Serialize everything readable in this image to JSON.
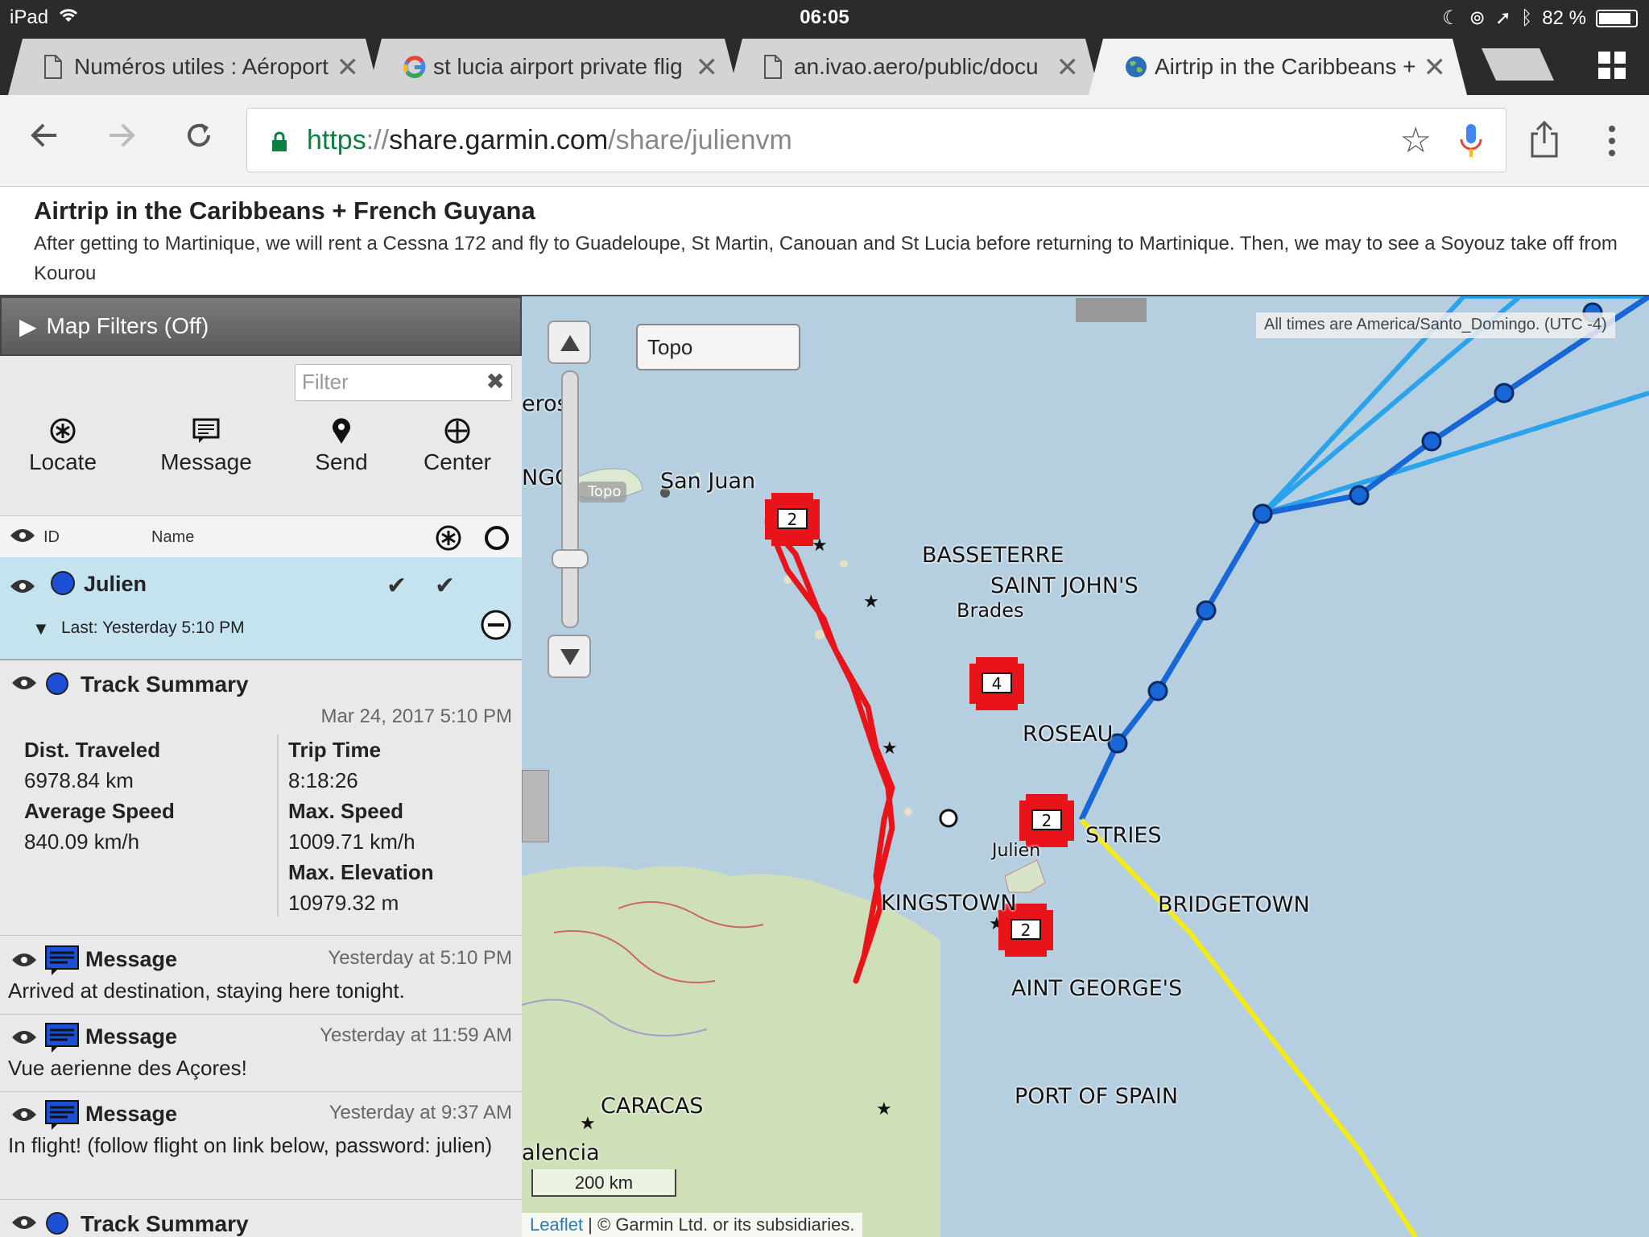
{
  "status_bar": {
    "device": "iPad",
    "time": "06:05",
    "battery": "82 %",
    "battery_level": 0.82
  },
  "tabs": [
    {
      "title": "Numéros utiles : Aéroport",
      "icon": "document-icon",
      "active": false
    },
    {
      "title": "st lucia airport private flig",
      "icon": "google-icon",
      "active": false
    },
    {
      "title": "an.ivao.aero/public/docu",
      "icon": "document-icon",
      "active": false
    },
    {
      "title": "Airtrip in the Caribbeans +",
      "icon": "globe-icon",
      "active": true
    }
  ],
  "url": {
    "scheme": "https",
    "sep": "://",
    "host": "share.garmin.com",
    "path": "/share/julienvm"
  },
  "page": {
    "title": "Airtrip in the Caribbeans + French Guyana",
    "description": "After getting to Martinique, we will rent a Cessna 172 and fly to Guadeloupe, St Martin, Canouan and St Lucia before returning to Martinique. Then, we may to see a Soyouz take off from Kourou"
  },
  "panel": {
    "filters_label": "Map Filters (Off)",
    "filter_placeholder": "Filter",
    "actions": [
      {
        "label": "Locate",
        "icon": "locate-icon"
      },
      {
        "label": "Message",
        "icon": "message-icon"
      },
      {
        "label": "Send",
        "icon": "pin-icon"
      },
      {
        "label": "Center",
        "icon": "crosshair-icon"
      }
    ],
    "list_header": {
      "id": "ID",
      "name": "Name"
    },
    "user": {
      "name": "Julien",
      "last": "Last: Yesterday 5:10 PM",
      "color": "#1a4fd6"
    },
    "summary": {
      "title": "Track Summary",
      "date": "Mar 24, 2017 5:10 PM",
      "dist_label": "Dist. Traveled",
      "dist_value": "6978.84 km",
      "avg_label": "Average Speed",
      "avg_value": "840.09 km/h",
      "trip_label": "Trip Time",
      "trip_value": "8:18:26",
      "max_speed_label": "Max. Speed",
      "max_speed_value": "1009.71 km/h",
      "max_elev_label": "Max. Elevation",
      "max_elev_value": "10979.32 m"
    },
    "messages": [
      {
        "title": "Message",
        "time": "Yesterday at 5:10 PM",
        "text": "Arrived at destination, staying here tonight."
      },
      {
        "title": "Message",
        "time": "Yesterday at 11:59 AM",
        "text": "Vue aerienne des Açores!"
      },
      {
        "title": "Message",
        "time": "Yesterday at 9:37 AM",
        "text": "In flight! (follow flight on link below, password: julien)"
      }
    ],
    "summary2_title": "Track Summary"
  },
  "map": {
    "layer": "Topo",
    "tz_note": "All times are America/Santo_Domingo. (UTC -4)",
    "scale": "200 km",
    "attribution_link": "Leaflet",
    "attribution_text": " | © Garmin Ltd. or its subsidiaries.",
    "topo_mini": "Topo",
    "labels": {
      "san_juan": "San Juan",
      "basseterre": "BASSETERRE",
      "saint_johns": "SAINT JOHN'S",
      "brades": "Brades",
      "roseau": "ROSEAU",
      "castries": "STRIES",
      "julien": "Julien",
      "kingstown": "KINGSTOWN",
      "bridgetown": "BRIDGETOWN",
      "saint_georges": "AINT GEORGE'S",
      "port_of_spain": "PORT OF SPAIN",
      "caracas": "CARACAS",
      "valencia": "alencia",
      "edge1": "eros",
      "edge2": "NGO"
    },
    "markers": [
      "2",
      "4",
      "2",
      "2"
    ]
  },
  "colors": {
    "route_red": "#e8141a",
    "route_blue": "#1767d6",
    "route_light_blue": "#2aa3ea",
    "route_yellow": "#f3ea16"
  }
}
